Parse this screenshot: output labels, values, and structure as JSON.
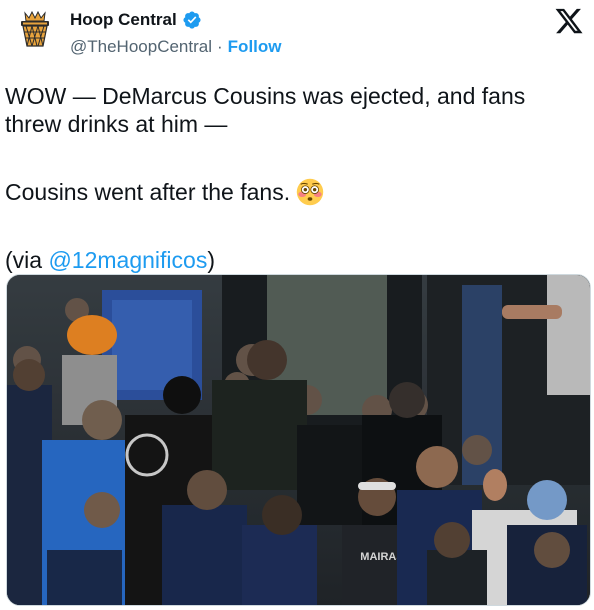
{
  "author": {
    "name": "Hoop Central",
    "handle": "@TheHoopCentral",
    "separator": "·",
    "follow_label": "Follow",
    "avatar_icon": "hoop-central-logo",
    "verified_icon": "verified-badge-icon"
  },
  "platform_icon": "x-logo-icon",
  "tweet": {
    "line1": "WOW — DeMarcus Cousins was ejected, and fans threw drinks at him —",
    "line2": "Cousins went after the fans.",
    "line2_emoji": "flushed-face-emoji",
    "line3_prefix": "(via ",
    "line3_mention": "@12magnificos",
    "line3_suffix": ")"
  },
  "media": {
    "type": "video-still",
    "jersey_text": "MAIRAS"
  },
  "colors": {
    "text": "#0f1419",
    "secondary": "#536471",
    "accent": "#1d9bf0",
    "logo_orange": "#e8a33c"
  }
}
